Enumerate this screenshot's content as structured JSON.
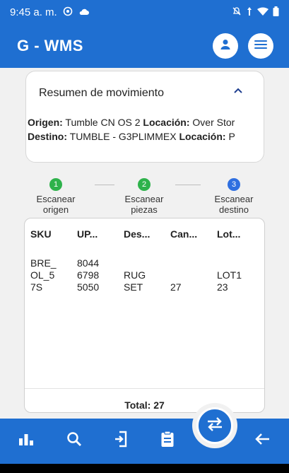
{
  "statusbar": {
    "time": "9:45 a. m.",
    "left_icons": [
      "whatsapp-icon",
      "cloud-icon"
    ],
    "right_icons": [
      "notifications-off-icon",
      "signal-icon",
      "wifi-icon",
      "battery-icon"
    ]
  },
  "appbar": {
    "title": "G - WMS",
    "profile_icon": "person-icon",
    "menu_icon": "menu-icon"
  },
  "summary": {
    "title": "Resumen de movimiento",
    "origen_label": "Origen:",
    "origen_value": "Tumble CN OS 2",
    "origen_loc_label": "Locación:",
    "origen_loc_value": "Over Stor",
    "destino_label": "Destino:",
    "destino_value": "TUMBLE - G3PLIMMEX",
    "destino_loc_label": "Locación:",
    "destino_loc_value": "P"
  },
  "stepper": {
    "steps": [
      {
        "number": "1",
        "label_1": "Escanear",
        "label_2": "origen",
        "color": "#2eb24b"
      },
      {
        "number": "2",
        "label_1": "Escanear",
        "label_2": "piezas",
        "color": "#2eb24b"
      },
      {
        "number": "3",
        "label_1": "Escanear",
        "label_2": "destino",
        "color": "#2f6fe0"
      }
    ]
  },
  "table": {
    "headers": [
      "SKU",
      "UP...",
      "Des...",
      "Can...",
      "Lot..."
    ],
    "rows": [
      {
        "sku": "BRE_\nOL_5\n7S",
        "upc": "8044\n6798\n5050",
        "desc": "RUG\nSET",
        "cantidad": "27",
        "lote": "LOT1\n23"
      }
    ],
    "total_label": "Total: 27"
  },
  "bottomnav": {
    "items": [
      "bar-chart-icon",
      "search-icon",
      "exit-to-app-icon",
      "clipboard-icon",
      "back-arrow-icon"
    ],
    "fab_icon": "swap-horizontal-icon"
  },
  "colors": {
    "primary": "#1f6fd1",
    "step_done": "#2eb24b",
    "step_active": "#2f6fe0"
  }
}
